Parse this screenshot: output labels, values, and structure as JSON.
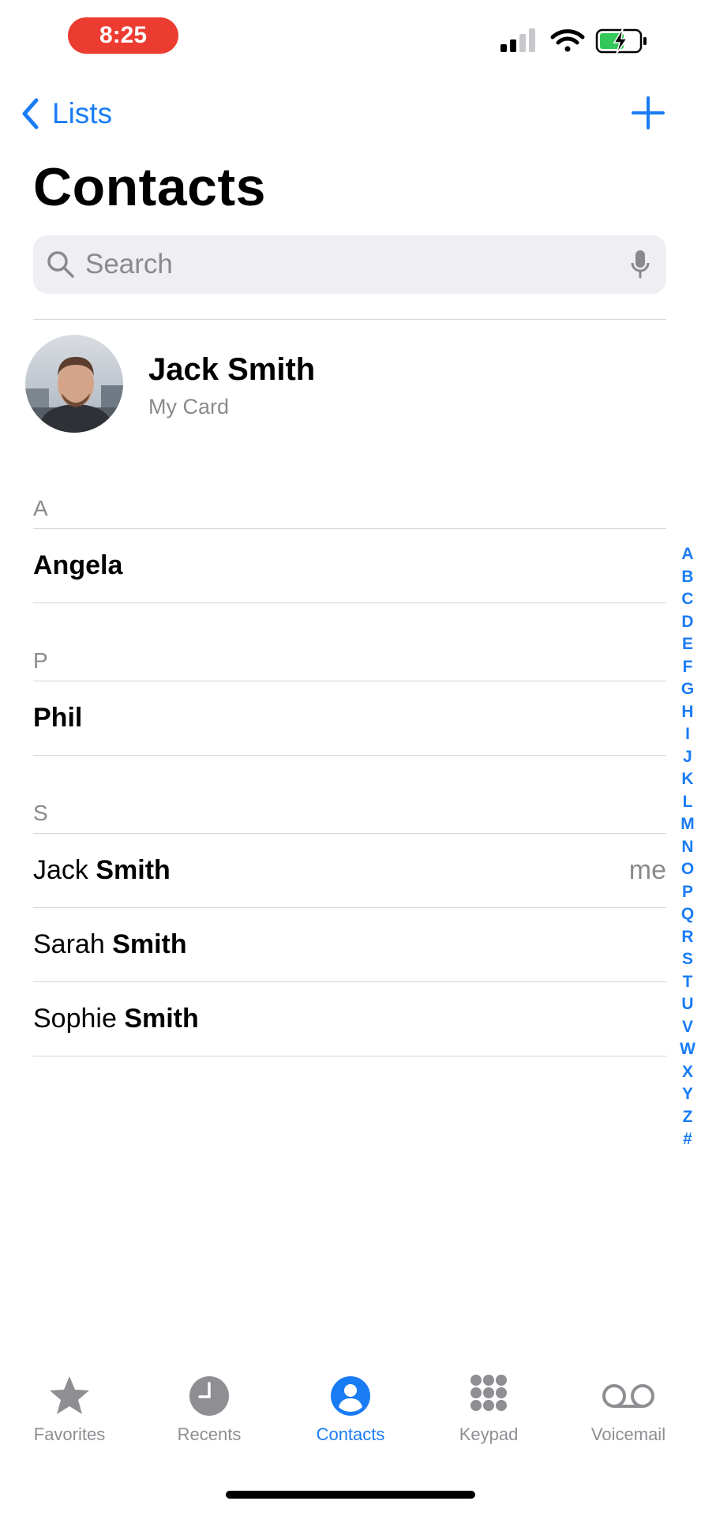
{
  "status_bar": {
    "time": "8:25",
    "colors": {
      "time_pill": "#ec3b30",
      "battery_fill": "#34c759"
    }
  },
  "nav": {
    "back_label": "Lists",
    "add_icon": "plus-icon",
    "accent": "#1a7cf5"
  },
  "page_title": "Contacts",
  "search": {
    "placeholder": "Search",
    "value": ""
  },
  "my_card": {
    "name": "Jack Smith",
    "subtitle": "My Card"
  },
  "sections": [
    {
      "letter": "A",
      "rows": [
        {
          "first": "",
          "last": "Angela",
          "me": ""
        }
      ]
    },
    {
      "letter": "P",
      "rows": [
        {
          "first": "",
          "last": "Phil",
          "me": ""
        }
      ]
    },
    {
      "letter": "S",
      "rows": [
        {
          "first": "Jack ",
          "last": "Smith",
          "me": "me"
        },
        {
          "first": "Sarah ",
          "last": "Smith",
          "me": ""
        },
        {
          "first": "Sophie ",
          "last": "Smith",
          "me": ""
        }
      ]
    }
  ],
  "index_letters": [
    "A",
    "B",
    "C",
    "D",
    "E",
    "F",
    "G",
    "H",
    "I",
    "J",
    "K",
    "L",
    "M",
    "N",
    "O",
    "P",
    "Q",
    "R",
    "S",
    "T",
    "U",
    "V",
    "W",
    "X",
    "Y",
    "Z",
    "#"
  ],
  "tabs": [
    {
      "label": "Favorites",
      "icon": "star-icon",
      "active": false
    },
    {
      "label": "Recents",
      "icon": "clock-icon",
      "active": false
    },
    {
      "label": "Contacts",
      "icon": "person-circle-icon",
      "active": true
    },
    {
      "label": "Keypad",
      "icon": "keypad-icon",
      "active": false
    },
    {
      "label": "Voicemail",
      "icon": "voicemail-icon",
      "active": false
    }
  ]
}
